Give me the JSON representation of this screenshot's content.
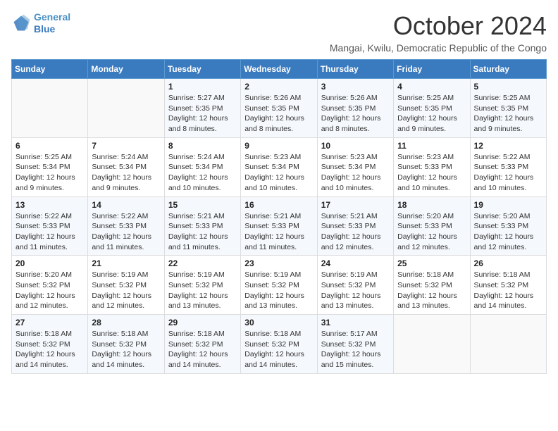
{
  "logo": {
    "line1": "General",
    "line2": "Blue"
  },
  "title": "October 2024",
  "subtitle": "Mangai, Kwilu, Democratic Republic of the Congo",
  "days_header": [
    "Sunday",
    "Monday",
    "Tuesday",
    "Wednesday",
    "Thursday",
    "Friday",
    "Saturday"
  ],
  "weeks": [
    [
      {
        "num": "",
        "sunrise": "",
        "sunset": "",
        "daylight": ""
      },
      {
        "num": "",
        "sunrise": "",
        "sunset": "",
        "daylight": ""
      },
      {
        "num": "1",
        "sunrise": "Sunrise: 5:27 AM",
        "sunset": "Sunset: 5:35 PM",
        "daylight": "Daylight: 12 hours and 8 minutes."
      },
      {
        "num": "2",
        "sunrise": "Sunrise: 5:26 AM",
        "sunset": "Sunset: 5:35 PM",
        "daylight": "Daylight: 12 hours and 8 minutes."
      },
      {
        "num": "3",
        "sunrise": "Sunrise: 5:26 AM",
        "sunset": "Sunset: 5:35 PM",
        "daylight": "Daylight: 12 hours and 8 minutes."
      },
      {
        "num": "4",
        "sunrise": "Sunrise: 5:25 AM",
        "sunset": "Sunset: 5:35 PM",
        "daylight": "Daylight: 12 hours and 9 minutes."
      },
      {
        "num": "5",
        "sunrise": "Sunrise: 5:25 AM",
        "sunset": "Sunset: 5:35 PM",
        "daylight": "Daylight: 12 hours and 9 minutes."
      }
    ],
    [
      {
        "num": "6",
        "sunrise": "Sunrise: 5:25 AM",
        "sunset": "Sunset: 5:34 PM",
        "daylight": "Daylight: 12 hours and 9 minutes."
      },
      {
        "num": "7",
        "sunrise": "Sunrise: 5:24 AM",
        "sunset": "Sunset: 5:34 PM",
        "daylight": "Daylight: 12 hours and 9 minutes."
      },
      {
        "num": "8",
        "sunrise": "Sunrise: 5:24 AM",
        "sunset": "Sunset: 5:34 PM",
        "daylight": "Daylight: 12 hours and 10 minutes."
      },
      {
        "num": "9",
        "sunrise": "Sunrise: 5:23 AM",
        "sunset": "Sunset: 5:34 PM",
        "daylight": "Daylight: 12 hours and 10 minutes."
      },
      {
        "num": "10",
        "sunrise": "Sunrise: 5:23 AM",
        "sunset": "Sunset: 5:34 PM",
        "daylight": "Daylight: 12 hours and 10 minutes."
      },
      {
        "num": "11",
        "sunrise": "Sunrise: 5:23 AM",
        "sunset": "Sunset: 5:33 PM",
        "daylight": "Daylight: 12 hours and 10 minutes."
      },
      {
        "num": "12",
        "sunrise": "Sunrise: 5:22 AM",
        "sunset": "Sunset: 5:33 PM",
        "daylight": "Daylight: 12 hours and 10 minutes."
      }
    ],
    [
      {
        "num": "13",
        "sunrise": "Sunrise: 5:22 AM",
        "sunset": "Sunset: 5:33 PM",
        "daylight": "Daylight: 12 hours and 11 minutes."
      },
      {
        "num": "14",
        "sunrise": "Sunrise: 5:22 AM",
        "sunset": "Sunset: 5:33 PM",
        "daylight": "Daylight: 12 hours and 11 minutes."
      },
      {
        "num": "15",
        "sunrise": "Sunrise: 5:21 AM",
        "sunset": "Sunset: 5:33 PM",
        "daylight": "Daylight: 12 hours and 11 minutes."
      },
      {
        "num": "16",
        "sunrise": "Sunrise: 5:21 AM",
        "sunset": "Sunset: 5:33 PM",
        "daylight": "Daylight: 12 hours and 11 minutes."
      },
      {
        "num": "17",
        "sunrise": "Sunrise: 5:21 AM",
        "sunset": "Sunset: 5:33 PM",
        "daylight": "Daylight: 12 hours and 12 minutes."
      },
      {
        "num": "18",
        "sunrise": "Sunrise: 5:20 AM",
        "sunset": "Sunset: 5:33 PM",
        "daylight": "Daylight: 12 hours and 12 minutes."
      },
      {
        "num": "19",
        "sunrise": "Sunrise: 5:20 AM",
        "sunset": "Sunset: 5:33 PM",
        "daylight": "Daylight: 12 hours and 12 minutes."
      }
    ],
    [
      {
        "num": "20",
        "sunrise": "Sunrise: 5:20 AM",
        "sunset": "Sunset: 5:32 PM",
        "daylight": "Daylight: 12 hours and 12 minutes."
      },
      {
        "num": "21",
        "sunrise": "Sunrise: 5:19 AM",
        "sunset": "Sunset: 5:32 PM",
        "daylight": "Daylight: 12 hours and 12 minutes."
      },
      {
        "num": "22",
        "sunrise": "Sunrise: 5:19 AM",
        "sunset": "Sunset: 5:32 PM",
        "daylight": "Daylight: 12 hours and 13 minutes."
      },
      {
        "num": "23",
        "sunrise": "Sunrise: 5:19 AM",
        "sunset": "Sunset: 5:32 PM",
        "daylight": "Daylight: 12 hours and 13 minutes."
      },
      {
        "num": "24",
        "sunrise": "Sunrise: 5:19 AM",
        "sunset": "Sunset: 5:32 PM",
        "daylight": "Daylight: 12 hours and 13 minutes."
      },
      {
        "num": "25",
        "sunrise": "Sunrise: 5:18 AM",
        "sunset": "Sunset: 5:32 PM",
        "daylight": "Daylight: 12 hours and 13 minutes."
      },
      {
        "num": "26",
        "sunrise": "Sunrise: 5:18 AM",
        "sunset": "Sunset: 5:32 PM",
        "daylight": "Daylight: 12 hours and 14 minutes."
      }
    ],
    [
      {
        "num": "27",
        "sunrise": "Sunrise: 5:18 AM",
        "sunset": "Sunset: 5:32 PM",
        "daylight": "Daylight: 12 hours and 14 minutes."
      },
      {
        "num": "28",
        "sunrise": "Sunrise: 5:18 AM",
        "sunset": "Sunset: 5:32 PM",
        "daylight": "Daylight: 12 hours and 14 minutes."
      },
      {
        "num": "29",
        "sunrise": "Sunrise: 5:18 AM",
        "sunset": "Sunset: 5:32 PM",
        "daylight": "Daylight: 12 hours and 14 minutes."
      },
      {
        "num": "30",
        "sunrise": "Sunrise: 5:18 AM",
        "sunset": "Sunset: 5:32 PM",
        "daylight": "Daylight: 12 hours and 14 minutes."
      },
      {
        "num": "31",
        "sunrise": "Sunrise: 5:17 AM",
        "sunset": "Sunset: 5:32 PM",
        "daylight": "Daylight: 12 hours and 15 minutes."
      },
      {
        "num": "",
        "sunrise": "",
        "sunset": "",
        "daylight": ""
      },
      {
        "num": "",
        "sunrise": "",
        "sunset": "",
        "daylight": ""
      }
    ]
  ]
}
